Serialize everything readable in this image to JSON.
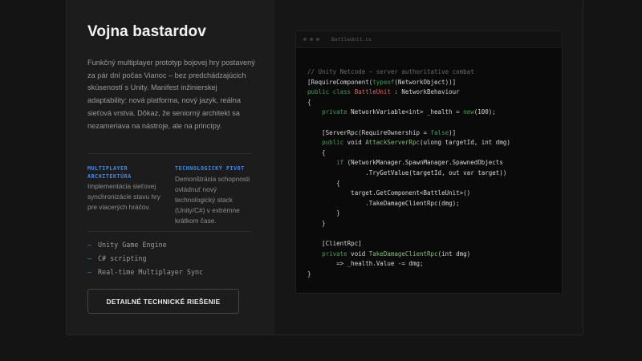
{
  "project": {
    "title": "Vojna bastardov",
    "description": "Funkčný multiplayer prototyp bojovej hry postavený za pár dní počas Vianoc – bez predchádzajúcich skúseností s Unity. Manifest inžinierskej adaptability: nová platforma, nový jazyk, reálna sieťová vrstva. Dôkaz, že seniorný architekt sa nezameriava na nástroje, ale na princípy."
  },
  "features": [
    {
      "title": "MULTIPLAYER ARCHITEKTÚRA",
      "text": "Implementácia sieťovej synchronizácie stavu hry pre viacerých hráčov."
    },
    {
      "title": "TECHNOLOGICKÝ PIVOT",
      "text": "Demonštrácia schopnosti ovládnuť nový technologický stack (Unity/C#) v extrémne krátkom čase."
    }
  ],
  "tech_stack": {
    "bullet": "–",
    "items": [
      "Unity Game Engine",
      "C# scripting",
      "Real-time Multiplayer Sync"
    ]
  },
  "cta": {
    "label": "DETAILNÉ TECHNICKÉ RIEŠENIE"
  },
  "editor": {
    "filename": "BattleUnit.cs",
    "lines": [
      [
        [
          "c",
          "// Unity Netcode – server authoritative combat"
        ]
      ],
      [
        [
          "p",
          "[RequireComponent("
        ],
        [
          "k",
          "typeof"
        ],
        [
          "p",
          "(NetworkObject))]"
        ]
      ],
      [
        [
          "k",
          "public class "
        ],
        [
          "t",
          "BattleUnit"
        ],
        [
          "p",
          " : NetworkBehaviour"
        ]
      ],
      [
        [
          "p",
          "{"
        ]
      ],
      [
        [
          "p",
          "    "
        ],
        [
          "k",
          "private"
        ],
        [
          "p",
          " NetworkVariable<int> _health = "
        ],
        [
          "k",
          "new"
        ],
        [
          "p",
          "(100);"
        ]
      ],
      [],
      [
        [
          "p",
          "    [ServerRpc(RequireOwnership = "
        ],
        [
          "k",
          "false"
        ],
        [
          "p",
          ")]"
        ]
      ],
      [
        [
          "p",
          "    "
        ],
        [
          "k",
          "public"
        ],
        [
          "p",
          " void "
        ],
        [
          "f",
          "AttackServerRpc"
        ],
        [
          "p",
          "(ulong targetId, int dmg)"
        ]
      ],
      [
        [
          "p",
          "    {"
        ]
      ],
      [
        [
          "p",
          "        "
        ],
        [
          "k",
          "if"
        ],
        [
          "p",
          " (NetworkManager.SpawnManager.SpawnedObjects"
        ]
      ],
      [
        [
          "p",
          "                .TryGetValue(targetId, out var target))"
        ]
      ],
      [
        [
          "p",
          "        {"
        ]
      ],
      [
        [
          "p",
          "            target.GetComponent<BattleUnit>()"
        ]
      ],
      [
        [
          "p",
          "                .TakeDamageClientRpc(dmg);"
        ]
      ],
      [
        [
          "p",
          "        }"
        ]
      ],
      [
        [
          "p",
          "    }"
        ]
      ],
      [],
      [
        [
          "p",
          "    [ClientRpc]"
        ]
      ],
      [
        [
          "p",
          "    "
        ],
        [
          "k",
          "private"
        ],
        [
          "p",
          " void "
        ],
        [
          "f",
          "TakeDamageClientRpc"
        ],
        [
          "p",
          "(int dmg)"
        ]
      ],
      [
        [
          "p",
          "        => _health.Value -= dmg;"
        ]
      ],
      [
        [
          "p",
          "}"
        ]
      ]
    ]
  }
}
